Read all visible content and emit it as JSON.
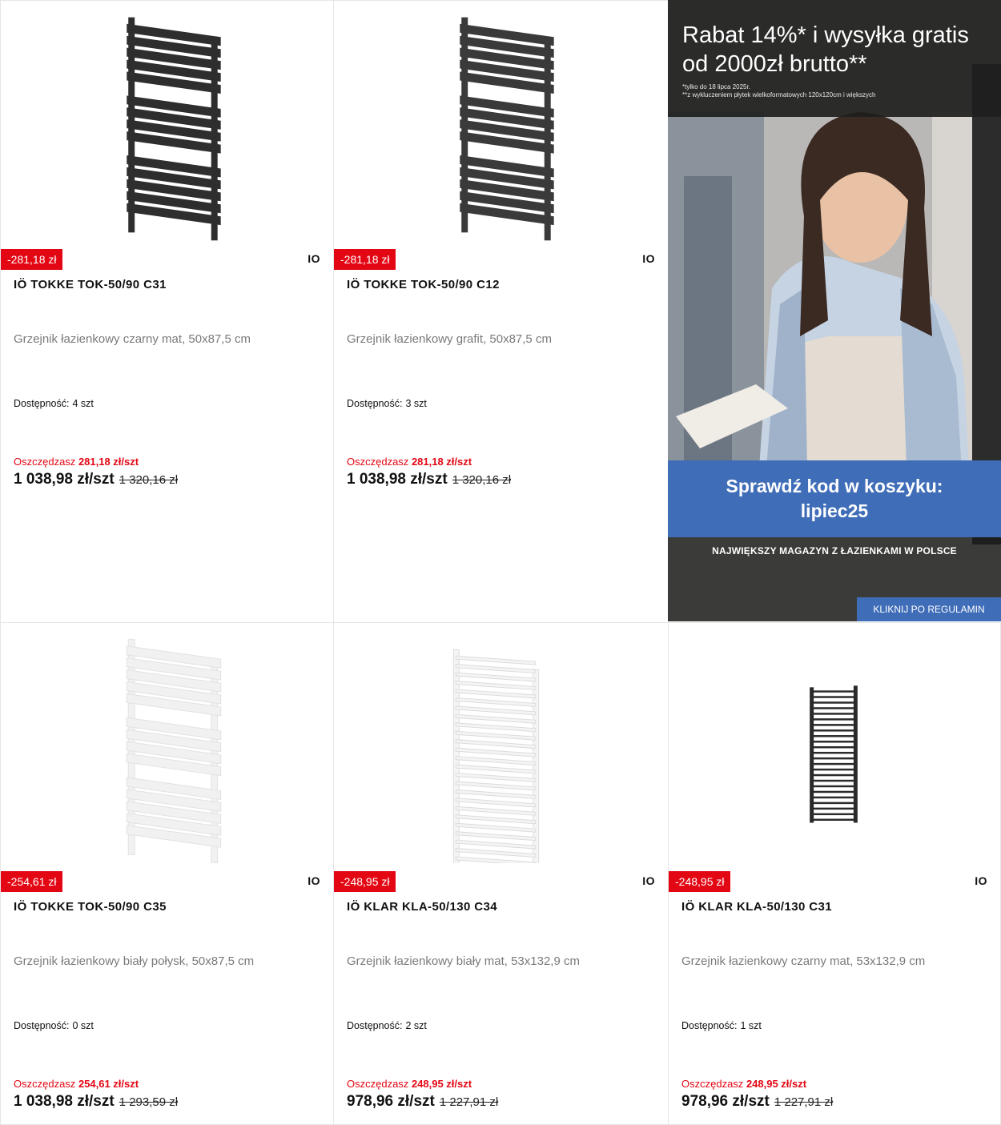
{
  "products": [
    {
      "discount_badge": "-281,18 zł",
      "brand": "IO",
      "title": "IÖ TOKKE TOK-50/90 C31",
      "description": "Grzejnik łazienkowy czarny mat, 50x87,5 cm",
      "availability_label": "Dostępność:",
      "availability_value": "4 szt",
      "savings_label": "Oszczędzasz",
      "savings_value": "281,18 zł/szt",
      "price": "1 038,98 zł/szt",
      "old_price": "1 320,16 zł",
      "image_color": "#2e2e2e",
      "image_icon": "flat-panel-radiator-icon"
    },
    {
      "discount_badge": "-281,18 zł",
      "brand": "IO",
      "title": "IÖ TOKKE TOK-50/90 C12",
      "description": "Grzejnik łazienkowy grafit, 50x87,5 cm",
      "availability_label": "Dostępność:",
      "availability_value": "3 szt",
      "savings_label": "Oszczędzasz",
      "savings_value": "281,18 zł/szt",
      "price": "1 038,98 zł/szt",
      "old_price": "1 320,16 zł",
      "image_color": "#3a3a3a",
      "image_icon": "flat-panel-radiator-icon"
    },
    {
      "discount_badge": "-254,61 zł",
      "brand": "IO",
      "title": "IÖ TOKKE TOK-50/90 C35",
      "description": "Grzejnik łazienkowy biały połysk, 50x87,5 cm",
      "availability_label": "Dostępność:",
      "availability_value": "0 szt",
      "savings_label": "Oszczędzasz",
      "savings_value": "254,61 zł/szt",
      "price": "1 038,98 zł/szt",
      "old_price": "1 293,59 zł",
      "image_color": "#f1f1f1",
      "image_icon": "flat-panel-radiator-icon"
    },
    {
      "discount_badge": "-248,95 zł",
      "brand": "IO",
      "title": "IÖ KLAR KLA-50/130 C34",
      "description": "Grzejnik łazienkowy biały mat, 53x132,9 cm",
      "availability_label": "Dostępność:",
      "availability_value": "2 szt",
      "savings_label": "Oszczędzasz",
      "savings_value": "248,95 zł/szt",
      "price": "978,96 zł/szt",
      "old_price": "1 227,91 zł",
      "image_color": "#f4f4f4",
      "image_icon": "ladder-radiator-icon"
    },
    {
      "discount_badge": "-248,95 zł",
      "brand": "IO",
      "title": "IÖ KLAR KLA-50/130 C31",
      "description": "Grzejnik łazienkowy czarny mat, 53x132,9 cm",
      "availability_label": "Dostępność:",
      "availability_value": "1 szt",
      "savings_label": "Oszczędzasz",
      "savings_value": "248,95 zł/szt",
      "price": "978,96 zł/szt",
      "old_price": "1 227,91 zł",
      "image_color": "#2a2a2a",
      "image_icon": "ladder-radiator-icon"
    }
  ],
  "promo": {
    "headline": "Rabat 14%* i wysyłka gratis od 2000zł brutto**",
    "footnote_1": "*tylko do 18 lipca 2025r.",
    "footnote_2": "**z wykluczeniem płytek wielkoformatowych 120x120cm i większych",
    "code_line_1": "Sprawdź kod w koszyku:",
    "code_line_2": "lipiec25",
    "tagline": "NAJWIĘKSZY MAGAZYN Z ŁAZIENKAMI W POLSCE",
    "cta": "KLIKNIJ PO REGULAMIN",
    "image_icon": "woman-holding-tile-photo",
    "accent_color": "#3f6db8"
  },
  "colors": {
    "badge": "#e30613",
    "savings": "#e30613"
  }
}
